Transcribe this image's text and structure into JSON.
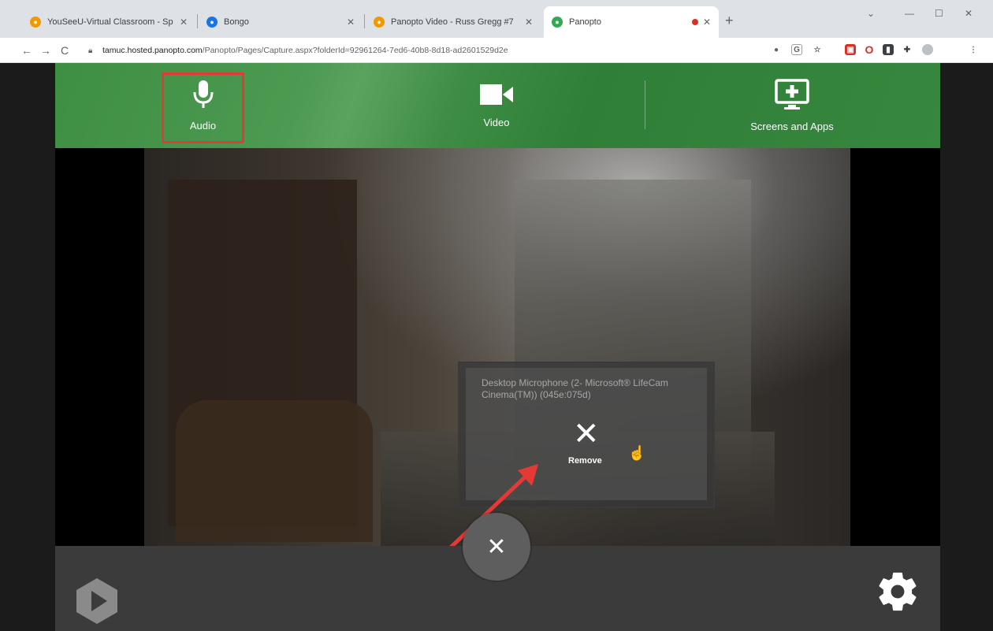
{
  "browser": {
    "tabs": [
      {
        "title": "YouSeeU-Virtual Classroom - Sp",
        "favicon_color": "#f29900",
        "active": false
      },
      {
        "title": "Bongo",
        "favicon_color": "#1a73e8",
        "active": false
      },
      {
        "title": "Panopto Video - Russ Gregg #7",
        "favicon_color": "#f29900",
        "active": false
      },
      {
        "title": "Panopto",
        "favicon_color": "#34a853",
        "active": true,
        "recording": true
      }
    ],
    "url": {
      "host": "tamuc.hosted.panopto.com",
      "path": "/Panopto/Pages/Capture.aspx?folderId=92961264-7ed6-40b8-8d18-ad2601529d2e"
    }
  },
  "sources": {
    "audio": {
      "label": "Audio",
      "icon": "microphone-icon"
    },
    "video": {
      "label": "Video",
      "icon": "camera-icon"
    },
    "screens": {
      "label": "Screens and Apps",
      "icon": "screen-add-icon"
    }
  },
  "overlay": {
    "device_name": "Desktop Microphone (2- Microsoft® LifeCam Cinema(TM)) (045e:075d)",
    "remove_label": "Remove"
  },
  "colors": {
    "panopto_green": "#3e8e43",
    "highlight_red": "#e53935",
    "bottom_bar": "#3b3b3b"
  }
}
